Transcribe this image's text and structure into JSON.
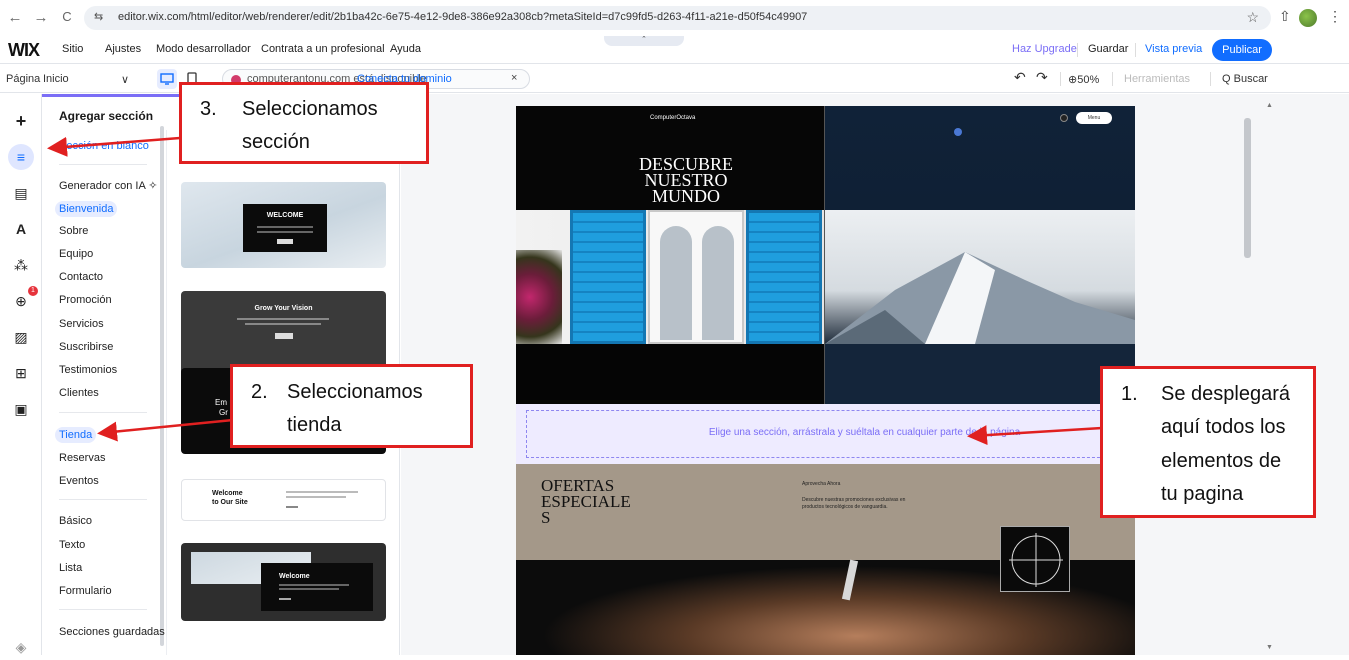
{
  "browser": {
    "url": "editor.wix.com/html/editor/web/renderer/edit/2b1ba42c-6e75-4e12-9de8-386e92a308cb?metaSiteId=d7c99fd5-d263-4f11-a21e-d50f54c49907",
    "nav_back": "←",
    "nav_forward": "→",
    "nav_reload": "C",
    "site_info": "⇆",
    "star": "☆",
    "extensions": "⇧",
    "reading_list": "≡",
    "menu": "⋮"
  },
  "wix_bar": {
    "logo": "WIX",
    "menu": [
      "Sitio",
      "Ajustes",
      "Modo desarrollador",
      "Contrata a un profesional",
      "Ayuda"
    ],
    "pull_tab": "ˆ",
    "upgrade": "Haz Upgrade",
    "save": "Guardar",
    "preview": "Vista previa",
    "publish": "Publicar"
  },
  "toolbar": {
    "page_label": "Página",
    "page_value": "Inicio",
    "dropdown_arrow": "∨",
    "domain_text": "computerantonu.com está disponible",
    "domain_link": "Conecta tu dominio",
    "domain_close": "×",
    "undo": "↶",
    "redo": "↷",
    "zoom": "⊕50%",
    "tools": "Herramientas",
    "search": "Q Buscar"
  },
  "rail": {
    "add_icon": "+",
    "sections_icon": "≡",
    "pages_icon": "▤",
    "design_icon": "A",
    "apps_icon": "⁂",
    "market_icon": "⊕",
    "media_icon": "▨",
    "table_icon": "⊞",
    "business_icon": "▣",
    "layers_icon": "◈",
    "badge": "1"
  },
  "panel": {
    "title": "Agregar sección",
    "blank_section": "Sección en blanco",
    "ai_generator": "Generador con IA ✧",
    "categories_a": [
      "Bienvenida",
      "Sobre",
      "Equipo",
      "Contacto",
      "Promoción",
      "Servicios",
      "Suscribirse",
      "Testimonios",
      "Clientes"
    ],
    "categories_b": [
      "Tienda",
      "Reservas",
      "Eventos"
    ],
    "categories_c": [
      "Básico",
      "Texto",
      "Lista",
      "Formulario"
    ],
    "saved": "Secciones guardadas",
    "thumb_1": "WELCOME",
    "thumb_2": "Grow Your Vision",
    "thumb_3a": "Em",
    "thumb_3b": "Gr",
    "thumb_4a": "Welcome",
    "thumb_4b": "to Our Site",
    "thumb_5": "Welcome"
  },
  "site": {
    "brand": "ComputerOctava",
    "menu_pill": "Menu",
    "hero_line1": "DESCUBRE",
    "hero_line2": "NUESTRO",
    "hero_line3": "MUNDO",
    "drop_text": "Elige una sección, arrástrala y suéltala en cualquier parte de la página",
    "offer_line1": "OFERTAS",
    "offer_line2": "ESPECIALE",
    "offer_line3": "S",
    "offer_small_title": "Aprovecha Ahora",
    "offer_small_text": "Descubre nuestras promociones exclusivas en productos tecnológicos de vanguardia."
  },
  "annotations": {
    "a1_num": "1.",
    "a1_text_1": "Se desplegará",
    "a1_text_2": "aquí todos los",
    "a1_text_3": "elementos de",
    "a1_text_4": "tu pagina",
    "a2_num": "2.",
    "a2_text_1": "Seleccionamos",
    "a2_text_2": "tienda",
    "a3_num": "3.",
    "a3_text_1": "Seleccionamos",
    "a3_text_2": "sección"
  },
  "colors": {
    "accent": "#116dff",
    "annotation_red": "#e02020",
    "panel_highlight": "#7b6ef6",
    "drop_zone": "#eeebff"
  }
}
